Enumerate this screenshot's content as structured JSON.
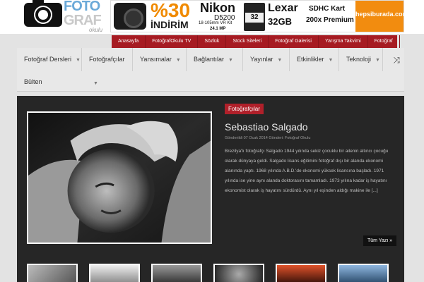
{
  "logo": {
    "word_top": "FOTO",
    "word_bottom": "GRAF",
    "sub": "okulu"
  },
  "ad": {
    "percent": "%30",
    "discount": "İNDİRİM",
    "brand": "Nikon",
    "model": "D5200",
    "lens": "18-105mm VR Kit",
    "mp": "24.1 MP",
    "card_label": "32",
    "card_brand": "Lexar",
    "card_size": "32GB",
    "card_type": "SDHC Kart",
    "card_speed": "200x Premium",
    "store": "hepsiburada.com"
  },
  "red_nav": [
    "Anasayfa",
    "FotoğrafOkulu TV",
    "Sözlük",
    "Stock Siteleri",
    "Fotoğraf Galerisi",
    "Yarışma Takvimi",
    "Fotoğraf"
  ],
  "menu": {
    "items": [
      {
        "label": "Fotoğraf Dersleri"
      },
      {
        "label": "Fotoğrafçılar"
      },
      {
        "label": "Yansımalar"
      },
      {
        "label": "Bağlantılar"
      },
      {
        "label": "Yayınlar"
      },
      {
        "label": "Etkinlikler"
      },
      {
        "label": "Teknoloji"
      }
    ],
    "second_row": "Bülten",
    "shuffle_icon": "⤨"
  },
  "feature": {
    "category": "Fotoğrafçılar",
    "title": "Sebastiao Salgado",
    "meta": "Gönderildi 07 Ocak 2014 Gönderi: Fotoğraf Okulu",
    "description": "Brezilya'lı fotoğrafçı Salgado 1944 yılında sekiz çocuklu bir ailenin altıncı çocuğu olarak dünyaya geldi. Salgado lisans eğitimini fotoğraf dışı bir alanda ekonomi alanında yaptı. 1968 yılında A.B.D.'de ekonomi yüksek lisansına başladı. 1971 yılında ise yine aynı alanda doktorasını tamamladı. 1973 yılına kadar iş hayatını ekonomist olarak iş hayatını sürdürdü. Aynı yıl eşinden aldığı makine ile [...]",
    "more": "Tüm Yazı »"
  },
  "colors": {
    "red": "#a61b22",
    "dark_panel": "#262626",
    "orange": "#f28c0f"
  }
}
